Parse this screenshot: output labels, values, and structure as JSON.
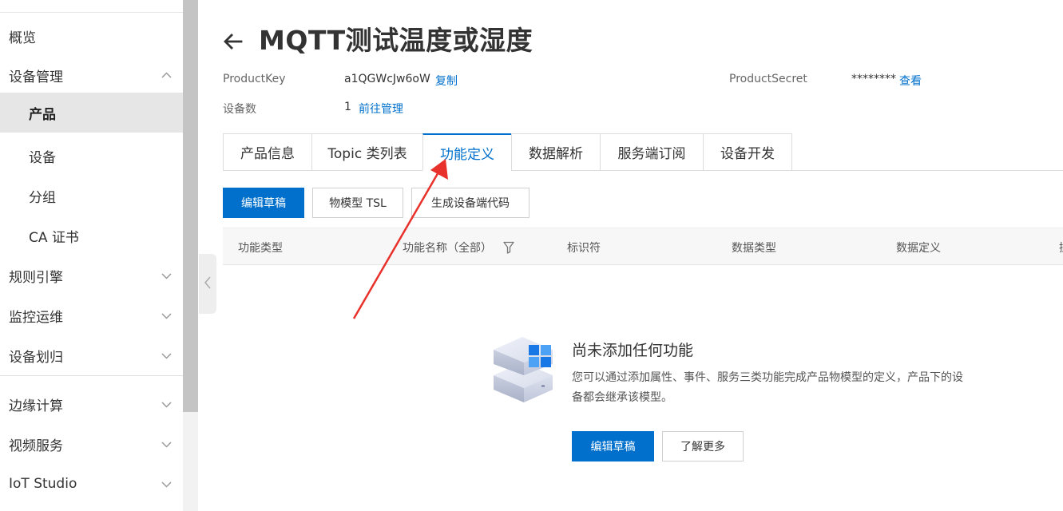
{
  "sidebar": {
    "items": [
      {
        "label": "概览"
      },
      {
        "label": "设备管理"
      },
      {
        "label": "产品"
      },
      {
        "label": "设备"
      },
      {
        "label": "分组"
      },
      {
        "label": "CA 证书"
      },
      {
        "label": "规则引擎"
      },
      {
        "label": "监控运维"
      },
      {
        "label": "设备划归"
      },
      {
        "label": "边缘计算"
      },
      {
        "label": "视频服务"
      },
      {
        "label": "IoT Studio"
      }
    ],
    "active_item": "产品"
  },
  "header": {
    "title": "MQTT测试温度或湿度",
    "product_key_label": "ProductKey",
    "product_key_value": "a1QGWcJw6oW",
    "copy_link": "复制",
    "product_secret_label": "ProductSecret",
    "product_secret_value": "********",
    "view_link": "查看",
    "device_count_label": "设备数",
    "device_count_value": "1",
    "manage_link": "前往管理"
  },
  "tabs": [
    {
      "label": "产品信息"
    },
    {
      "label": "Topic 类列表"
    },
    {
      "label": "功能定义"
    },
    {
      "label": "数据解析"
    },
    {
      "label": "服务端订阅"
    },
    {
      "label": "设备开发"
    }
  ],
  "active_tab": "功能定义",
  "toolbar": {
    "edit_draft": "编辑草稿",
    "tsl": "物模型 TSL",
    "gen_code": "生成设备端代码"
  },
  "table": {
    "columns": [
      "功能类型",
      "功能名称（全部）",
      "标识符",
      "数据类型",
      "数据定义",
      "操"
    ]
  },
  "empty_state": {
    "title": "尚未添加任何功能",
    "description": "您可以通过添加属性、事件、服务三类功能完成产品物模型的定义，产品下的设备都会继承该模型。",
    "edit_button": "编辑草稿",
    "learn_more_button": "了解更多"
  },
  "colors": {
    "accent": "#0070cc",
    "annotation_arrow": "#e8312a"
  },
  "icons": {
    "back": "arrow-left-icon",
    "filter": "filter-icon",
    "expand": "chevron-down-icon",
    "collapse": "chevron-up-icon",
    "sidebar_toggle": "chevron-left-icon",
    "empty_illustration": "server-box-icon"
  }
}
